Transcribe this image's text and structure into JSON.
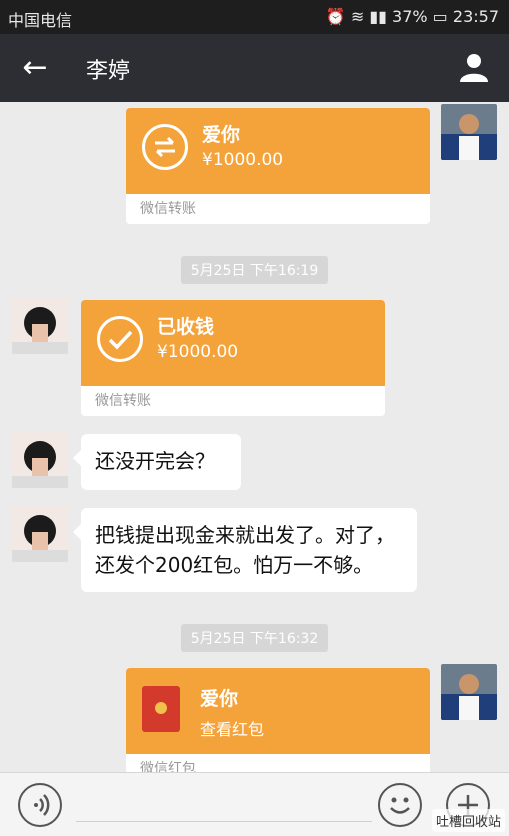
{
  "status_bar": {
    "carrier": "中国电信",
    "battery": "37%",
    "time": "23:57"
  },
  "header": {
    "title": "李婷"
  },
  "messages": [
    {
      "type": "transfer",
      "side": "right",
      "title": "爱你",
      "amount": "¥1000.00",
      "footer": "微信转账"
    },
    {
      "type": "time",
      "text": "5月25日 下午16:19"
    },
    {
      "type": "transfer",
      "side": "left",
      "title": "已收钱",
      "amount": "¥1000.00",
      "footer": "微信转账"
    },
    {
      "type": "text",
      "side": "left",
      "text": "还没开完会？"
    },
    {
      "type": "text",
      "side": "left",
      "text_line1": "把钱提出现金来就出发了。对了，",
      "text_line2": "还发个200红包。怕万一不够。"
    },
    {
      "type": "time",
      "text": "5月25日 下午16:32"
    },
    {
      "type": "red_packet",
      "side": "right",
      "title": "爱你",
      "subtitle": "查看红包",
      "footer": "微信红包"
    }
  ],
  "watermark": "吐槽回收站",
  "colors": {
    "orange": "#f4a23a",
    "header": "#2d2e33",
    "background": "#ebebeb",
    "red_packet": "#d33a2b"
  }
}
